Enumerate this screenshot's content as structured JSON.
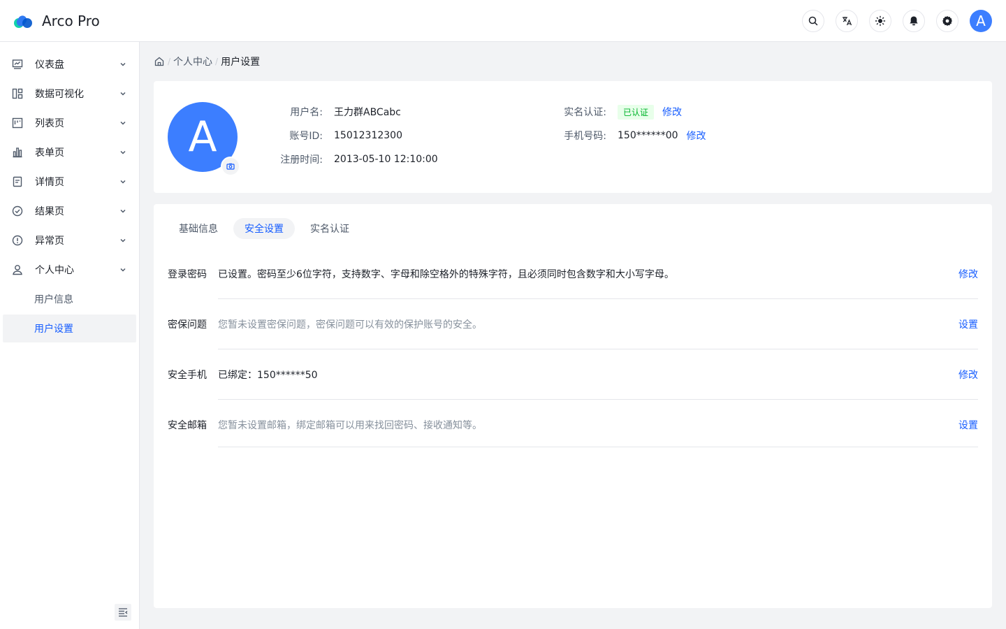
{
  "header": {
    "app_title": "Arco Pro",
    "avatar_letter": "A",
    "tools": [
      "search-icon",
      "translate-icon",
      "theme-icon",
      "bell-icon",
      "gear-icon"
    ]
  },
  "sidebar": {
    "items": [
      {
        "label": "仪表盘",
        "icon": "dashboard-icon"
      },
      {
        "label": "数据可视化",
        "icon": "visualization-icon"
      },
      {
        "label": "列表页",
        "icon": "list-icon"
      },
      {
        "label": "表单页",
        "icon": "form-icon"
      },
      {
        "label": "详情页",
        "icon": "detail-icon"
      },
      {
        "label": "结果页",
        "icon": "result-icon"
      },
      {
        "label": "异常页",
        "icon": "exception-icon"
      },
      {
        "label": "个人中心",
        "icon": "user-icon"
      }
    ],
    "sub_items": [
      {
        "label": "用户信息",
        "active": false
      },
      {
        "label": "用户设置",
        "active": true
      }
    ]
  },
  "breadcrumb": {
    "items": [
      "个人中心",
      "用户设置"
    ],
    "separator": "/"
  },
  "profile": {
    "avatar_letter": "A",
    "username_label": "用户名:",
    "username": "王力群ABCabc",
    "account_label": "账号ID:",
    "account_id": "15012312300",
    "registered_label": "注册时间:",
    "registered_at": "2013-05-10 12:10:00",
    "verify_label": "实名认证:",
    "verify_status": "已认证",
    "verify_action": "修改",
    "phone_label": "手机号码:",
    "phone": "150******00",
    "phone_action": "修改"
  },
  "settings": {
    "tabs": [
      {
        "label": "基础信息",
        "active": false
      },
      {
        "label": "安全设置",
        "active": true
      },
      {
        "label": "实名认证",
        "active": false
      }
    ],
    "rows": [
      {
        "label": "登录密码",
        "desc": "已设置。密码至少6位字符，支持数字、字母和除空格外的特殊字符，且必须同时包含数字和大小写字母。",
        "action": "修改",
        "set": true
      },
      {
        "label": "密保问题",
        "desc": "您暂未设置密保问题，密保问题可以有效的保护账号的安全。",
        "action": "设置",
        "set": false
      },
      {
        "label": "安全手机",
        "desc": "已绑定：150******50",
        "action": "修改",
        "set": true
      },
      {
        "label": "安全邮箱",
        "desc": "您暂未设置邮箱，绑定邮箱可以用来找回密码、接收通知等。",
        "action": "设置",
        "set": false
      }
    ]
  },
  "colors": {
    "primary": "#165dff",
    "avatar": "#3c7eff",
    "success": "#00b42a",
    "success_bg": "#e8ffea"
  }
}
